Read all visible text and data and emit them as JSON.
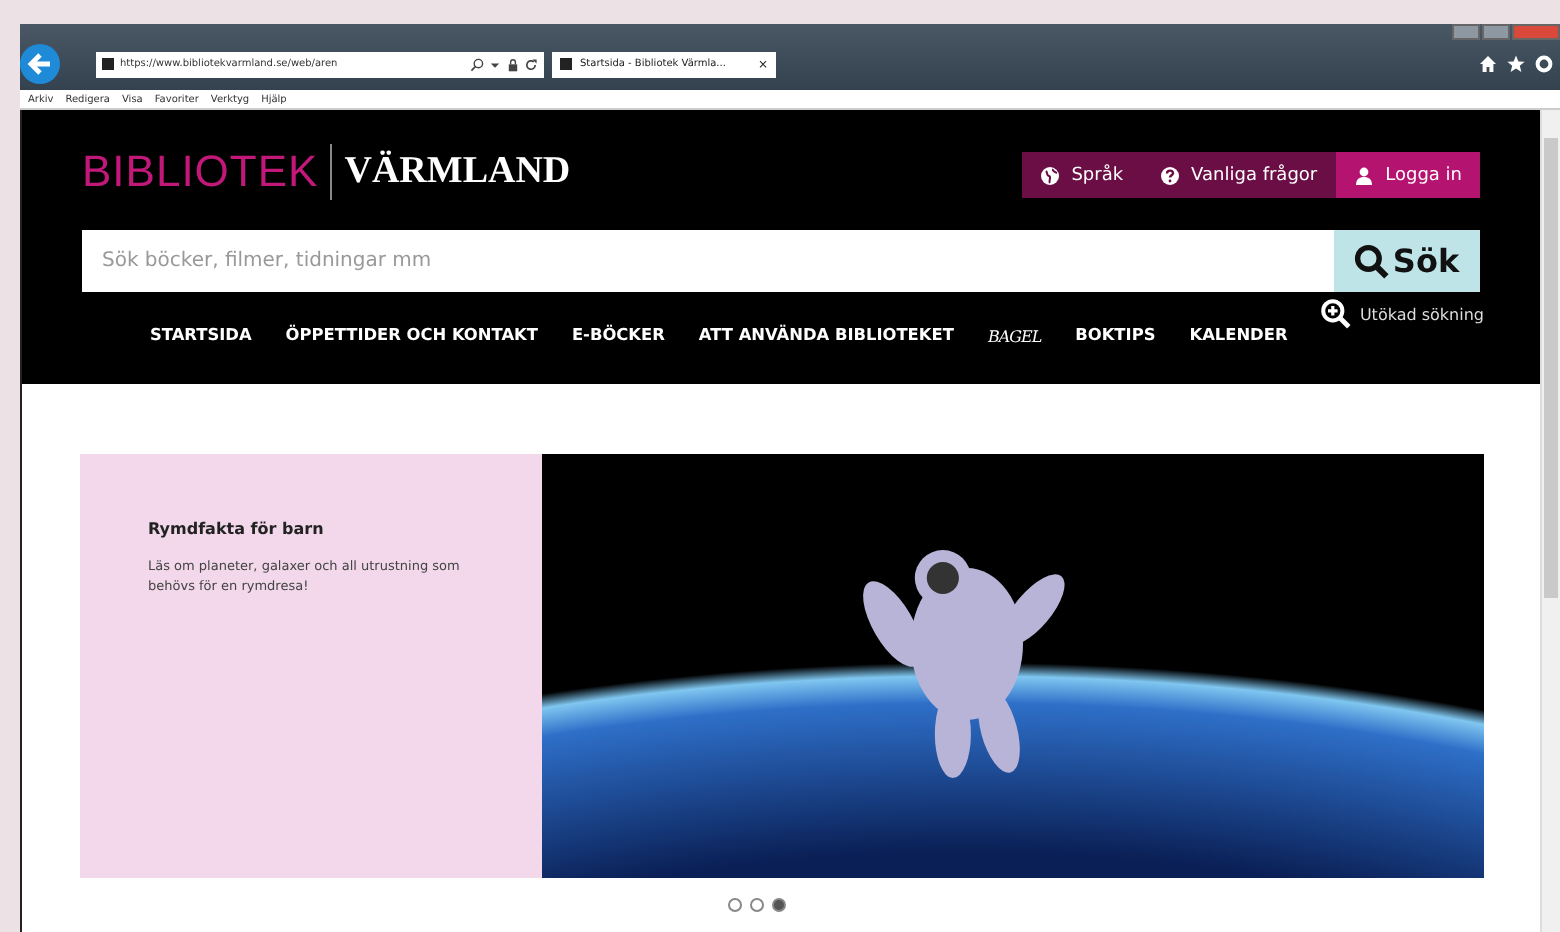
{
  "browser": {
    "address": "https://www.bibliotekvarmland.se/web/aren",
    "tabs": [
      {
        "title": "Startsida - Bibliotek Värmla...",
        "close": "×",
        "selected": true
      }
    ],
    "menu": [
      "Arkiv",
      "Redigera",
      "Visa",
      "Favoriter",
      "Verktyg",
      "Hjälp"
    ]
  },
  "header": {
    "logo_left": "BIBLIOTEK",
    "logo_right": "VÄRMLAND",
    "top_buttons": [
      {
        "kind": "globe",
        "label": "Språk",
        "selected": false
      },
      {
        "kind": "help",
        "label": "Vanliga frågor",
        "selected": false
      },
      {
        "kind": "user",
        "label": "Logga in",
        "selected": true
      }
    ],
    "search": {
      "placeholder": "Sök böcker, filmer, tidningar mm",
      "button": "Sök"
    },
    "advanced": "Utökad sökning",
    "nav": [
      {
        "label": "STARTSIDA",
        "kind": "text"
      },
      {
        "label": "ÖPPETTIDER OCH KONTAKT",
        "kind": "text"
      },
      {
        "label": "E-BÖCKER",
        "kind": "text"
      },
      {
        "label": "ATT ANVÄNDA BIBLIOTEKET",
        "kind": "text"
      },
      {
        "label": "BAGEL",
        "kind": "logo"
      },
      {
        "label": "BOKTIPS",
        "kind": "text"
      },
      {
        "label": "KALENDER",
        "kind": "text"
      }
    ]
  },
  "hero": {
    "title": "Rymdfakta för barn",
    "text": "Läs om planeter, galaxer och all utrustning som behövs för en rymdresa!",
    "dots": [
      {
        "selected": false
      },
      {
        "selected": false
      },
      {
        "selected": true
      }
    ]
  }
}
